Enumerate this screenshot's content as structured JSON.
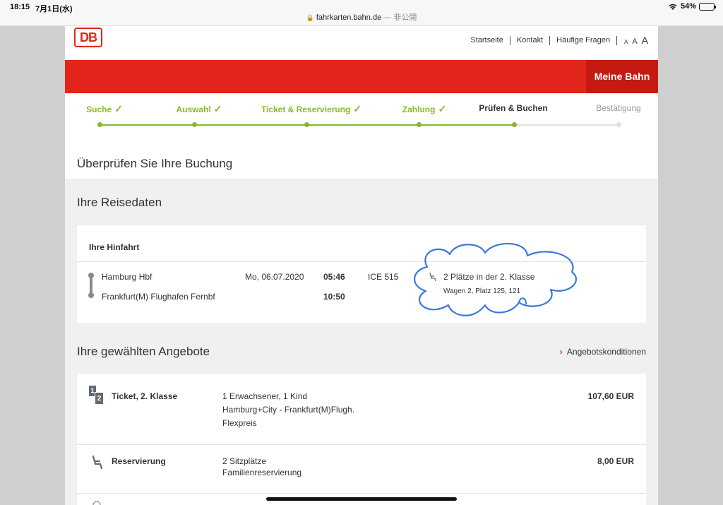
{
  "status": {
    "time": "18:15",
    "date": "7月1日(水)",
    "battery": "54%",
    "battery_level": 0.54
  },
  "url": {
    "host": "fahrkarten.bahn.de",
    "suffix": "— 非公開"
  },
  "brand": {
    "logo": "DB",
    "accent": "#e3261c",
    "accent_dark": "#c41a12",
    "green": "#8ab829"
  },
  "topnav": {
    "startseite": "Startseite",
    "kontakt": "Kontakt",
    "faq": "Häufige Fragen",
    "font_a1": "A",
    "font_a2": "A",
    "font_a3": "A"
  },
  "meine_bahn": "Meine Bahn",
  "steps": [
    {
      "label": "Suche",
      "state": "done"
    },
    {
      "label": "Auswahl",
      "state": "done"
    },
    {
      "label": "Ticket & Reservierung",
      "state": "done"
    },
    {
      "label": "Zahlung",
      "state": "done"
    },
    {
      "label": "Prüfen & Buchen",
      "state": "current"
    },
    {
      "label": "Bestätigung",
      "state": "future"
    }
  ],
  "page_title": "Überprüfen Sie Ihre Buchung",
  "reisedaten": {
    "title": "Ihre Reisedaten",
    "card_title": "Ihre Hinfahrt",
    "from": "Hamburg Hbf",
    "to": "Frankfurt(M) Flughafen Fernbf",
    "date": "Mo, 06.07.2020",
    "dep": "05:46",
    "arr": "10:50",
    "train": "ICE 515",
    "seats": "2 Plätze in der 2. Klasse",
    "seat_detail": "Wagen 2, Platz 125, 121"
  },
  "angebote": {
    "title": "Ihre gewählten Angebote",
    "link": "Angebotskonditionen",
    "ticket": {
      "icon_a": "1",
      "icon_b": "2",
      "label": "Ticket, 2. Klasse",
      "line1": "1 Erwachsener, 1 Kind",
      "line2": "Hamburg+City - Frankfurt(M)Flugh.",
      "line3": "Flexpreis",
      "price": "107,60 EUR"
    },
    "reservierung": {
      "label": "Reservierung",
      "line1": "2 Sitzplätze",
      "line2": "Familienreservierung",
      "price": "8,00 EUR"
    }
  }
}
